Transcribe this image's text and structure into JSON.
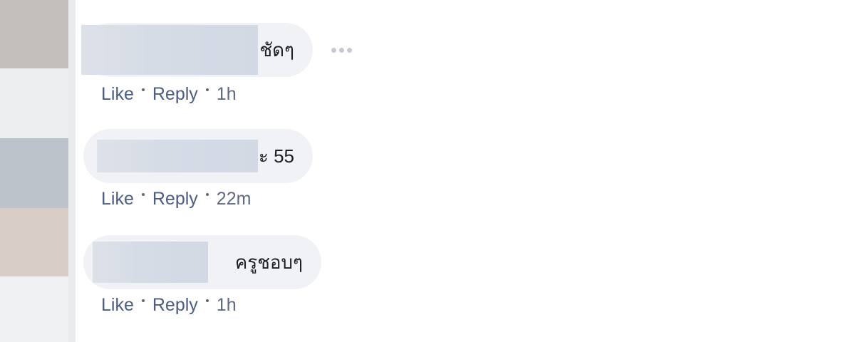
{
  "comments": [
    {
      "text_fragment": "ชัดๆ",
      "actions": {
        "like": "Like",
        "reply": "Reply",
        "time": "1h"
      }
    },
    {
      "text_fragment": "ะ 55",
      "actions": {
        "like": "Like",
        "reply": "Reply",
        "time": "22m"
      }
    },
    {
      "text_fragment": "ครูชอบๆ",
      "actions": {
        "like": "Like",
        "reply": "Reply",
        "time": "1h"
      }
    }
  ],
  "more_menu_icon": "ellipsis-icon",
  "colors": {
    "bubble_bg": "#f0f2f5",
    "action_text": "#4b5c84",
    "redaction": "#d6dce6"
  }
}
